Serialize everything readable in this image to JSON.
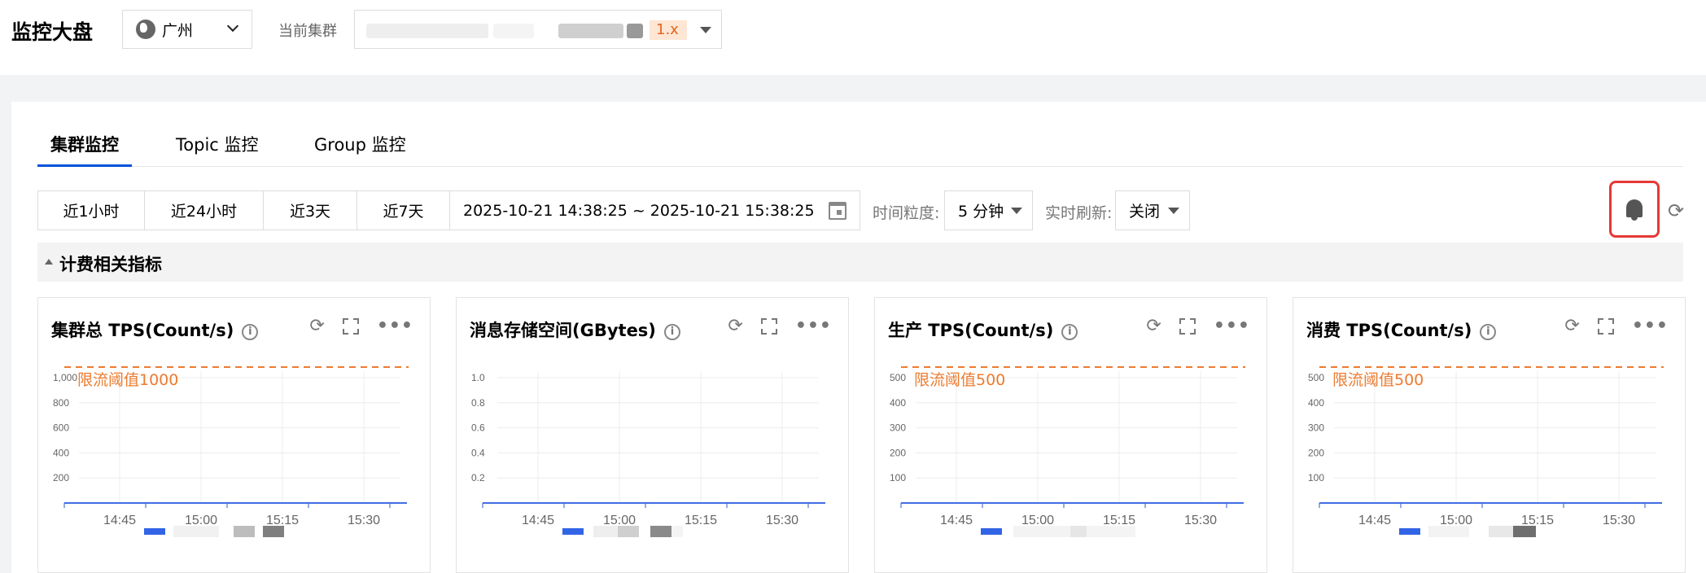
{
  "header": {
    "title": "监控大盘",
    "region": "广州",
    "cluster_label": "当前集群",
    "cluster_value_suffix": "1.x"
  },
  "tabs": [
    {
      "label": "集群监控",
      "active": true
    },
    {
      "label": "Topic 监控",
      "active": false
    },
    {
      "label": "Group 监控",
      "active": false
    }
  ],
  "timebar": {
    "quick": [
      "近1小时",
      "近24小时",
      "近3天",
      "近7天"
    ],
    "range": "2025-10-21 14:38:25   ~ 2025-10-21 15:38:25",
    "granularity_label": "时间粒度:",
    "granularity_value": "5 分钟",
    "refresh_label": "实时刷新:",
    "refresh_value": "关闭"
  },
  "section_title": "计费相关指标",
  "colors": {
    "accent": "#0052d9",
    "threshold": "#ed7b2f",
    "series": "#3264e6",
    "alarm_border": "#e53935"
  },
  "chart_data": [
    {
      "type": "line",
      "title": "集群总 TPS(Count/s)",
      "x_ticks": [
        "14:45",
        "15:00",
        "15:15",
        "15:30"
      ],
      "y_ticks": [
        "200",
        "400",
        "600",
        "800",
        "1,000"
      ],
      "ylim": [
        0,
        1000
      ],
      "threshold": {
        "value": 1000,
        "label": "限流阈值1000"
      },
      "series": [
        {
          "values": [
            0,
            0,
            0,
            0,
            0,
            0,
            0,
            0,
            0,
            0,
            0,
            0,
            0
          ]
        }
      ]
    },
    {
      "type": "line",
      "title": "消息存储空间(GBytes)",
      "x_ticks": [
        "14:45",
        "15:00",
        "15:15",
        "15:30"
      ],
      "y_ticks": [
        "0.2",
        "0.4",
        "0.6",
        "0.8",
        "1.0"
      ],
      "ylim": [
        0,
        1.0
      ],
      "threshold": null,
      "series": [
        {
          "values": [
            0,
            0,
            0,
            0,
            0,
            0,
            0,
            0,
            0,
            0,
            0,
            0,
            0
          ]
        }
      ]
    },
    {
      "type": "line",
      "title": "生产 TPS(Count/s)",
      "x_ticks": [
        "14:45",
        "15:00",
        "15:15",
        "15:30"
      ],
      "y_ticks": [
        "100",
        "200",
        "300",
        "400",
        "500"
      ],
      "ylim": [
        0,
        500
      ],
      "threshold": {
        "value": 500,
        "label": "限流阈值500"
      },
      "series": [
        {
          "values": [
            0,
            0,
            0,
            0,
            0,
            0,
            0,
            0,
            0,
            0,
            0,
            0,
            0
          ]
        }
      ]
    },
    {
      "type": "line",
      "title": "消费 TPS(Count/s)",
      "x_ticks": [
        "14:45",
        "15:00",
        "15:15",
        "15:30"
      ],
      "y_ticks": [
        "100",
        "200",
        "300",
        "400",
        "500"
      ],
      "ylim": [
        0,
        500
      ],
      "threshold": {
        "value": 500,
        "label": "限流阈值500"
      },
      "series": [
        {
          "values": [
            0,
            0,
            0,
            0,
            0,
            0,
            0,
            0,
            0,
            0,
            0,
            0,
            0
          ]
        }
      ]
    }
  ]
}
